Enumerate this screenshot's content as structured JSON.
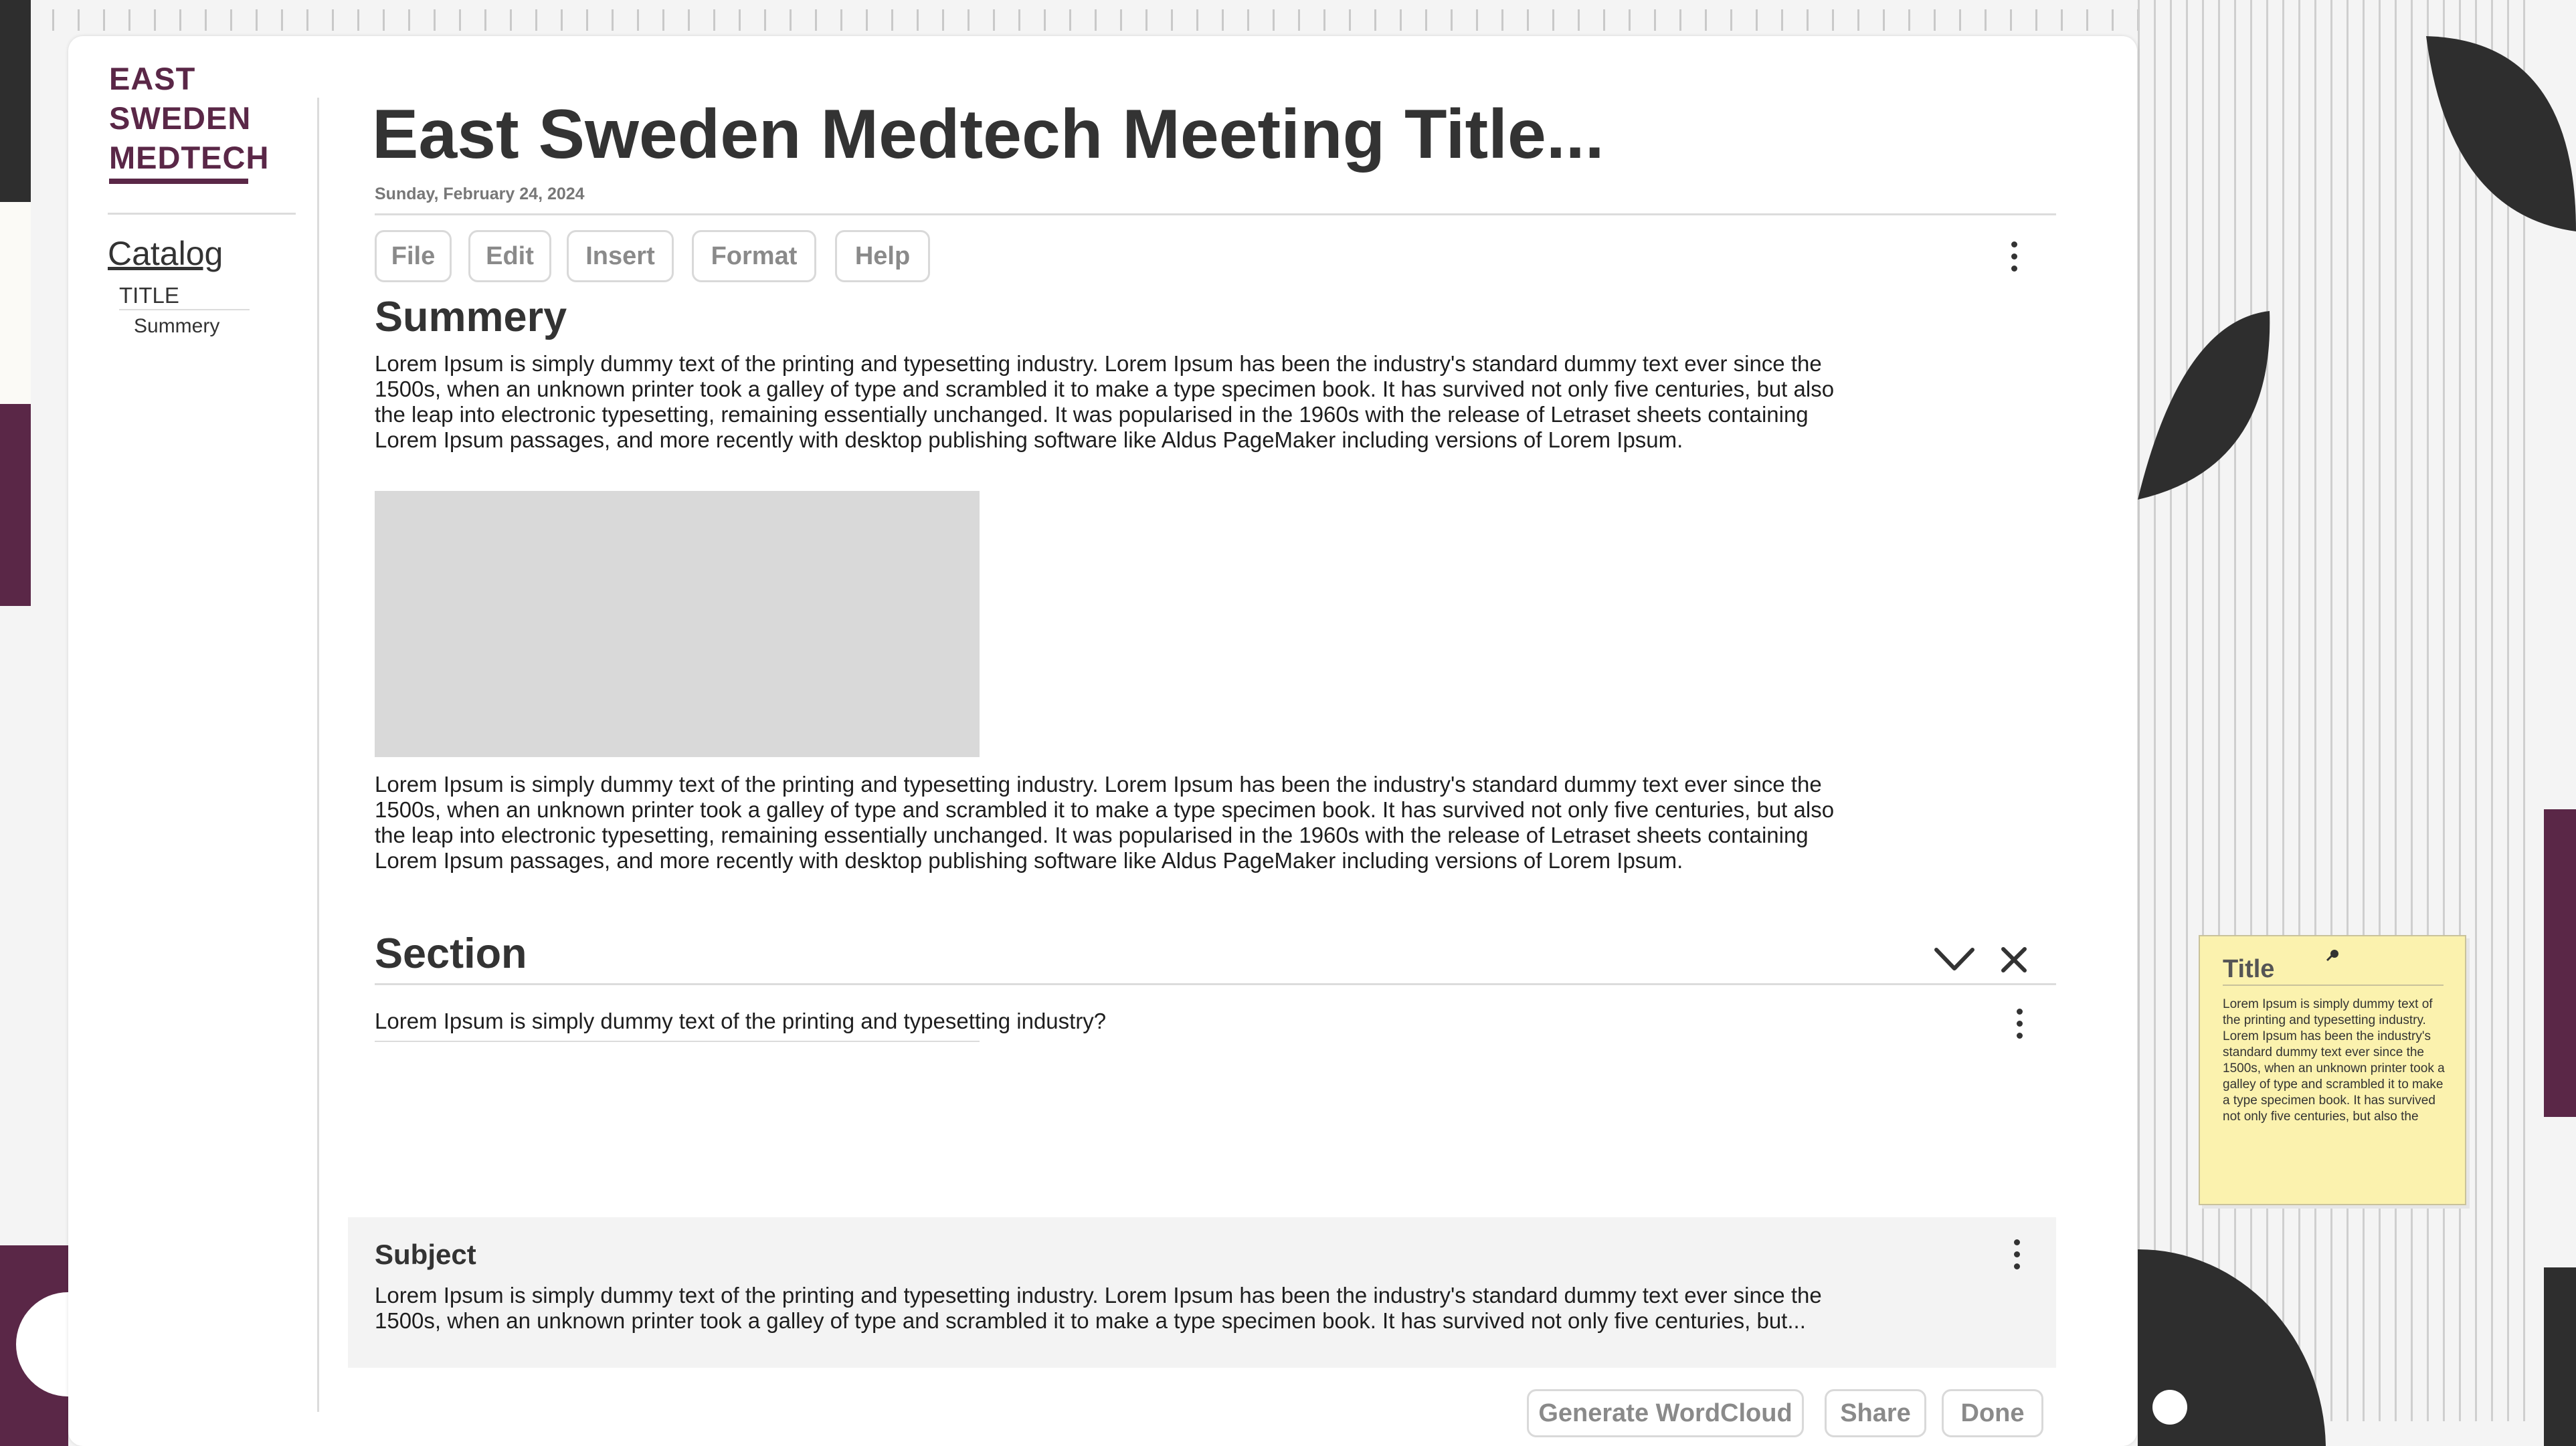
{
  "app": {
    "logo_lines": [
      "EAST",
      "SWEDEN",
      "MEDTECH"
    ],
    "brand_color": "#5a2747"
  },
  "sidebar": {
    "catalog_label": "Catalog",
    "items": [
      {
        "label": "TITLE"
      },
      {
        "label": "Summery"
      }
    ]
  },
  "header": {
    "title": "East Sweden Medtech Meeting Title...",
    "date": "Sunday, February 24, 2024"
  },
  "menu": {
    "items": [
      "File",
      "Edit",
      "Insert",
      "Format",
      "Help"
    ],
    "more_icon": "more-vertical-icon"
  },
  "summary": {
    "heading": "Summery",
    "paragraph_1": [
      "Lorem Ipsum is simply dummy text of the printing and typesetting industry. Lorem Ipsum has been the industry's standard dummy text ever since the",
      "1500s, when an unknown printer took a galley of type and scrambled it to make a type specimen book. It has survived not only five centuries, but also",
      "the leap into electronic typesetting, remaining essentially unchanged. It was popularised in the 1960s with the release of Letraset sheets containing",
      "Lorem Ipsum passages, and more recently with desktop publishing software like Aldus PageMaker including versions of Lorem Ipsum."
    ],
    "paragraph_2": [
      "Lorem Ipsum is simply dummy text of the printing and typesetting industry. Lorem Ipsum has been the industry's standard dummy text ever since the",
      "1500s, when an unknown printer took a galley of type and scrambled it to make a type specimen book. It has survived not only five centuries, but also",
      "the leap into electronic typesetting, remaining essentially unchanged. It was popularised in the 1960s with the release of Letraset sheets containing",
      "Lorem Ipsum passages, and more recently with desktop publishing software like Aldus PageMaker including versions of Lorem Ipsum."
    ]
  },
  "section": {
    "heading": "Section",
    "question": "Lorem Ipsum is simply dummy text of the printing and typesetting industry?"
  },
  "subject": {
    "heading": "Subject",
    "text": [
      "Lorem Ipsum is simply dummy text of the printing and typesetting industry. Lorem Ipsum has been the industry's standard dummy text ever since the",
      "1500s, when an unknown printer took a galley of type and scrambled it to make a type specimen book. It has survived not only five centuries, but..."
    ]
  },
  "actions": {
    "wordcloud_label": "Generate WordCloud",
    "share_label": "Share",
    "done_label": "Done"
  },
  "sticky_note": {
    "title": "Title",
    "text": "Lorem Ipsum is simply dummy text of the printing and typesetting industry. Lorem Ipsum has been the industry's standard dummy text ever since the 1500s, when an unknown printer took a galley of type and scrambled it to make a type specimen book. It has survived not only five centuries, but also the",
    "color": "#fbf2ae"
  },
  "colors": {
    "dark_shape": "#2e2e2e",
    "accent_purple": "#5a2747"
  }
}
